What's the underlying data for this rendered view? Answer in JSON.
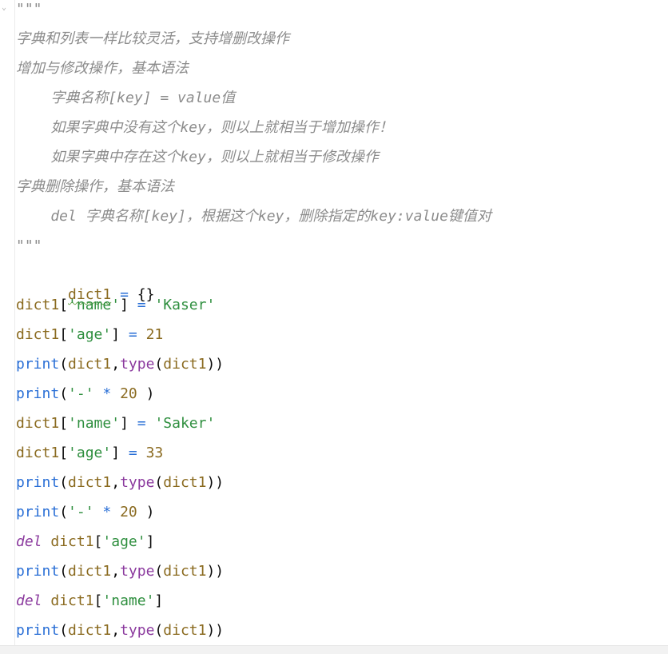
{
  "editor": {
    "docstring": {
      "open": "\"\"\"",
      "lines": [
        "字典和列表一样比较灵活，支持增删改操作",
        "增加与修改操作，基本语法",
        "    字典名称[key] = value值",
        "    如果字典中没有这个key，则以上就相当于增加操作！",
        "    如果字典中存在这个key，则以上就相当于修改操作",
        "字典删除操作，基本语法",
        "    del 字典名称[key]，根据这个key，删除指定的key:value键值对"
      ],
      "close": "\"\"\""
    },
    "code": {
      "ident": "dict1",
      "eq": "=",
      "empty_dict": "{}",
      "lbr": "[",
      "rbr": "]",
      "lpar": "(",
      "rpar": ")",
      "comma": ",",
      "star": "*",
      "key_name": "'name'",
      "key_age": "'age'",
      "val_kaser": "'Kaser'",
      "val_saker": "'Saker'",
      "num_21": "21",
      "num_33": "33",
      "num_20": "20",
      "dash": "'-'",
      "print": "print",
      "type": "type",
      "del": "del"
    }
  }
}
